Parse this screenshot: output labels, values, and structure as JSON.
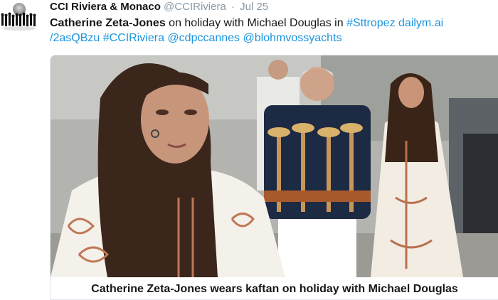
{
  "tweet": {
    "author_name": "CCI Riviera & Monaco",
    "handle": "@CCIRiviera",
    "separator": "·",
    "date": "Jul 25",
    "text": {
      "bold": "Catherine Zeta-Jones",
      "plain1": " on holiday with Michael Douglas in ",
      "hashtag1": "#Sttropez",
      "space1": " ",
      "link_part1": "dailym.ai",
      "link_part2": "/2asQBzu",
      "space2": " ",
      "hashtag2": "#CCIRiviera",
      "space3": " ",
      "mention1": "@cdpccannes",
      "space4": " ",
      "mention2": "@blohmvossyachts"
    }
  },
  "card": {
    "title": "Catherine Zeta-Jones wears kaftan on holiday with Michael Douglas"
  },
  "colors": {
    "link": "#1b95e0",
    "text": "#14171a",
    "muted": "#8899a6"
  },
  "icons": {
    "avatar": "crowd-globe-logo"
  }
}
